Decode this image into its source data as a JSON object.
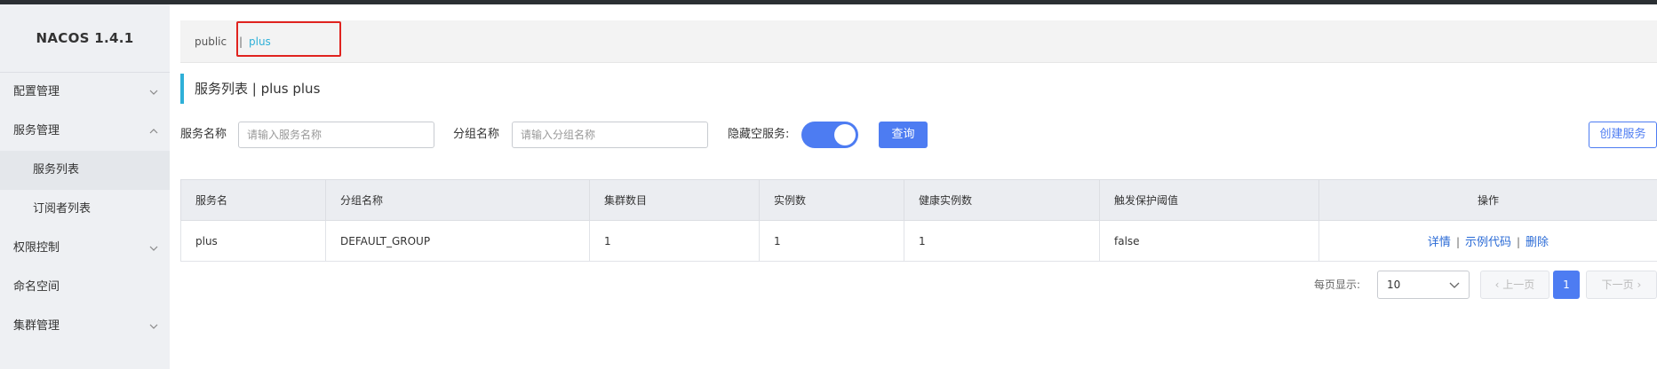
{
  "app": {
    "brand": "NACOS 1.4.1"
  },
  "sidebar": {
    "items": [
      {
        "label": "配置管理",
        "icon": "chevron-down-icon"
      },
      {
        "label": "服务管理",
        "icon": "chevron-up-icon"
      },
      {
        "label": "服务列表"
      },
      {
        "label": "订阅者列表"
      },
      {
        "label": "权限控制",
        "icon": "chevron-down-icon"
      },
      {
        "label": "命名空间"
      },
      {
        "label": "集群管理",
        "icon": "chevron-down-icon"
      }
    ]
  },
  "namespace": {
    "public": "public",
    "separator": "|",
    "current": "plus"
  },
  "page": {
    "title": "服务列表 | plus plus"
  },
  "filters": {
    "service_name_label": "服务名称",
    "service_name_placeholder": "请输入服务名称",
    "group_name_label": "分组名称",
    "group_name_placeholder": "请输入分组名称",
    "hide_empty_label": "隐藏空服务:",
    "hide_empty_on": true,
    "query_button": "查询",
    "create_button": "创建服务"
  },
  "table": {
    "headers": [
      "服务名",
      "分组名称",
      "集群数目",
      "实例数",
      "健康实例数",
      "触发保护阈值",
      "操作"
    ],
    "rows": [
      {
        "service": "plus",
        "group": "DEFAULT_GROUP",
        "clusters": "1",
        "instances": "1",
        "healthy": "1",
        "threshold": "false",
        "actions": [
          "详情",
          "示例代码",
          "删除"
        ]
      }
    ]
  },
  "pagination": {
    "per_page_label": "每页显示:",
    "per_page_value": "10",
    "prev": "上一页",
    "current_page": "1",
    "next": "下一页"
  },
  "colors": {
    "accent": "#4d7cf2",
    "link": "#2b6bd6",
    "namespace_active": "#2fb0d8",
    "highlight_box": "#e0231f"
  }
}
